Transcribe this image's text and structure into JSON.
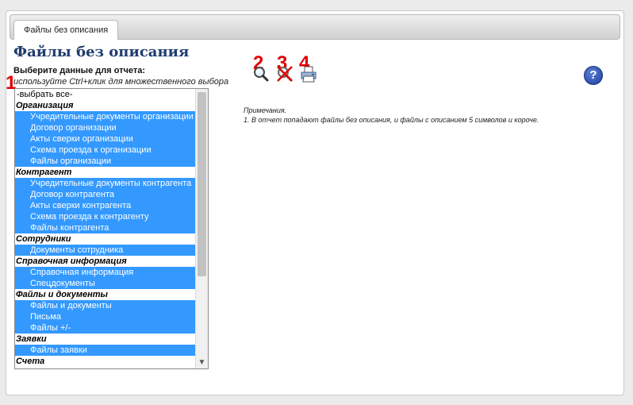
{
  "tabs": [
    {
      "label": "Файлы без описания",
      "active": true
    }
  ],
  "page": {
    "title": "Файлы без описания"
  },
  "markers": [
    "1",
    "2",
    "3",
    "4"
  ],
  "selector": {
    "label": "Выберите данные для отчета:",
    "hint": "используйте Ctrl+клик для множественного выбора",
    "rows": [
      {
        "text": "-выбрать все-",
        "kind": "plain"
      },
      {
        "text": "Организация",
        "kind": "group"
      },
      {
        "text": "Учредительные документы организации",
        "kind": "item"
      },
      {
        "text": "Договор организации",
        "kind": "item"
      },
      {
        "text": "Акты сверки организации",
        "kind": "item"
      },
      {
        "text": "Схема проезда к организации",
        "kind": "item"
      },
      {
        "text": "Файлы организации",
        "kind": "item"
      },
      {
        "text": "Контрагент",
        "kind": "group"
      },
      {
        "text": "Учредительные документы контрагента",
        "kind": "item"
      },
      {
        "text": "Договор контрагента",
        "kind": "item"
      },
      {
        "text": "Акты сверки контрагента",
        "kind": "item"
      },
      {
        "text": "Схема проезда к контрагенту",
        "kind": "item"
      },
      {
        "text": "Файлы контрагента",
        "kind": "item"
      },
      {
        "text": "Сотрудники",
        "kind": "group"
      },
      {
        "text": "Документы сотрудника",
        "kind": "item"
      },
      {
        "text": "Справочная информация",
        "kind": "group"
      },
      {
        "text": "Справочная информация",
        "kind": "item"
      },
      {
        "text": "Спецдокументы",
        "kind": "item"
      },
      {
        "text": "Файлы и документы",
        "kind": "group"
      },
      {
        "text": "Файлы и документы",
        "kind": "item"
      },
      {
        "text": "Письма",
        "kind": "item"
      },
      {
        "text": "Файлы +/-",
        "kind": "item"
      },
      {
        "text": "Заявки",
        "kind": "group"
      },
      {
        "text": "Файлы заявки",
        "kind": "item"
      },
      {
        "text": "Счета",
        "kind": "group"
      }
    ]
  },
  "toolbar": {
    "icons": [
      "search-icon",
      "clear-icon",
      "print-icon"
    ],
    "help": "?"
  },
  "notes": {
    "title": "Примечания.",
    "lines": [
      "1. В отчет попадают файлы без описания, и файлы с описанием 5 символов и короче."
    ]
  },
  "colors": {
    "selected": "#3399ff",
    "title": "#1f3c6e",
    "marker": "#e00000"
  }
}
